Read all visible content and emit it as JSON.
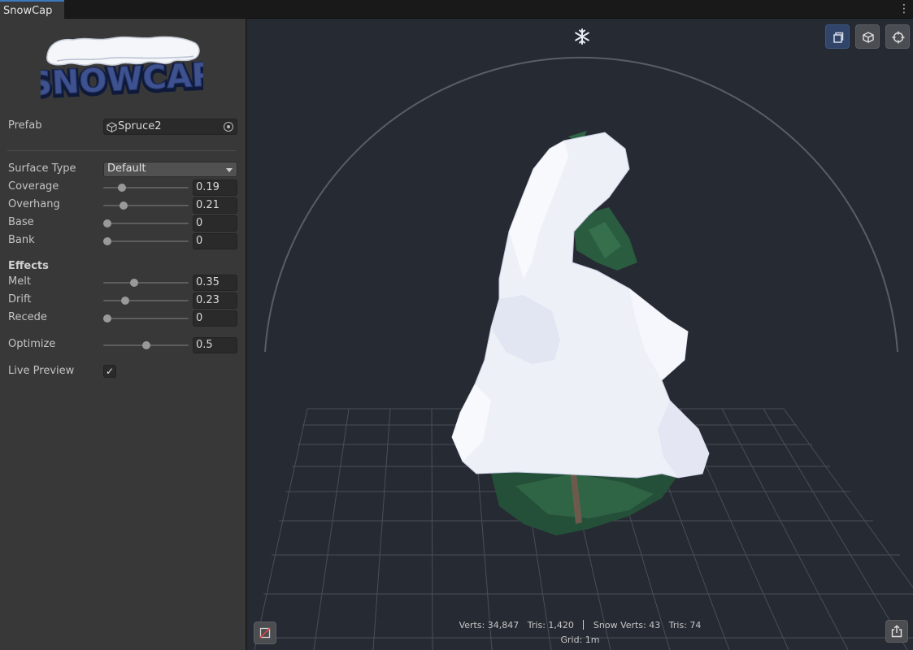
{
  "window": {
    "tab_title": "SnowCap",
    "menu_icon": "kebab-menu-icon"
  },
  "logo": {
    "text": "SNOWCAP"
  },
  "prefab": {
    "label": "Prefab",
    "value": "Spruce2",
    "icon": "prefab-cube-icon",
    "picker_icon": "object-picker-icon"
  },
  "surface": {
    "type_label": "Surface Type",
    "type_value": "Default",
    "params": [
      {
        "label": "Coverage",
        "value": "0.19",
        "level": 0.19
      },
      {
        "label": "Overhang",
        "value": "0.21",
        "level": 0.21
      },
      {
        "label": "Base",
        "value": "0",
        "level": 0
      },
      {
        "label": "Bank",
        "value": "0",
        "level": 0
      }
    ]
  },
  "effects": {
    "heading": "Effects",
    "params": [
      {
        "label": "Melt",
        "value": "0.35",
        "level": 0.35
      },
      {
        "label": "Drift",
        "value": "0.23",
        "level": 0.23
      },
      {
        "label": "Recede",
        "value": "0",
        "level": 0
      }
    ]
  },
  "optimize": {
    "label": "Optimize",
    "value": "0.5",
    "level": 0.5
  },
  "live_preview": {
    "label": "Live Preview",
    "checked": true,
    "check_glyph": "✓"
  },
  "viewport": {
    "background": "#262a33",
    "top_icon": "snowflake-icon",
    "toolbar": [
      {
        "name": "frame-view-button",
        "icon": "frame-icon",
        "active": true
      },
      {
        "name": "cube-view-button",
        "icon": "cube-icon",
        "active": false
      },
      {
        "name": "focus-button",
        "icon": "crosshair-icon",
        "active": false
      }
    ],
    "stats": {
      "verts": "Verts: 34,847",
      "tris": "Tris: 1,420",
      "snow_verts": "Snow Verts: 43",
      "snow_tris": "Tris: 74"
    },
    "grid": "Grid: 1m",
    "bottom_left_icon": "disable-render-icon",
    "bottom_right_icon": "export-icon"
  },
  "colors": {
    "accent": "#3a79bb",
    "snow": "#f2f3f9",
    "foliage": "#2a5a3e",
    "panel": "#383838"
  }
}
